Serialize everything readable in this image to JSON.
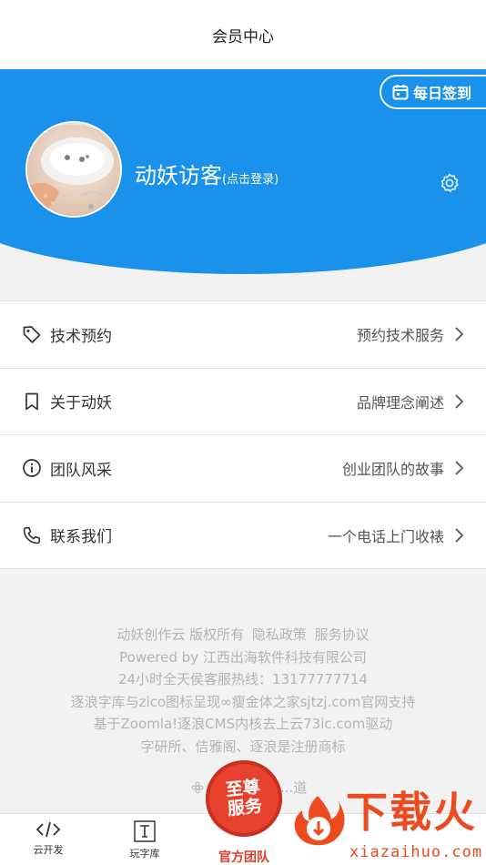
{
  "header": {
    "title": "会员中心"
  },
  "profile": {
    "checkin_label": "每日签到",
    "username": "动妖访客",
    "login_hint": "(点击登录)"
  },
  "menu": [
    {
      "label": "技术预约",
      "desc": "预约技术服务",
      "icon": "tag-icon"
    },
    {
      "label": "关于动妖",
      "desc": "品牌理念阐述",
      "icon": "bookmark-icon"
    },
    {
      "label": "团队风采",
      "desc": "创业团队的故事",
      "icon": "info-icon"
    },
    {
      "label": "联系我们",
      "desc": "一个电话上门收裱",
      "icon": "phone-icon"
    }
  ],
  "footer": {
    "brand": "动妖创作云 版权所有",
    "privacy": "隐私政策",
    "service": "服务协议",
    "powered": "Powered by 江西出海软件科技有限公司",
    "hotline": "24小时全天侯客服热线：13177777714",
    "support": "逐浪字库与zico图标呈现∞瘦金体之家sjtzj.com官网支持",
    "kernel": "基于Zoomla!逐浪CMS内核去上云73ic.com驱动",
    "trademark": "字研所、佶雅阁、逐浪是注册商标",
    "beian_text": "...道"
  },
  "tabbar": {
    "tab1": "云开发",
    "tab2": "玩字库"
  },
  "badge": {
    "line1": "至尊",
    "line2": "服务",
    "team": "官方团队"
  },
  "watermark": {
    "big": "下载火",
    "site": "xiazaihuo.com"
  },
  "colors": {
    "primary": "#1a91ea",
    "footer_text": "#b4b4b4",
    "badge_red": "#e8412d"
  }
}
